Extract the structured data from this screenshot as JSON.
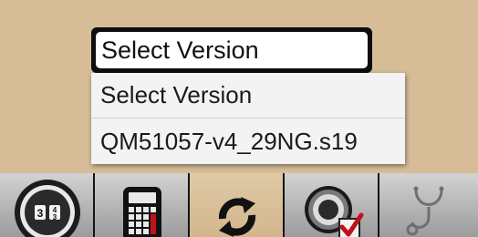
{
  "version_select": {
    "selected": "Select Version"
  },
  "dropdown": {
    "options": [
      "Select Version",
      "QM51057-v4_29NG.s19"
    ]
  },
  "toolbar": {
    "buttons": [
      {
        "icon": "number-dial-icon"
      },
      {
        "icon": "calculator-icon"
      },
      {
        "icon": "refresh-icon"
      },
      {
        "icon": "gauge-check-icon"
      },
      {
        "icon": "stethoscope-icon"
      }
    ],
    "active_index": 2
  },
  "colors": {
    "background": "#d6bd98",
    "toolbar": "#141414",
    "active_button": "#d2b68d",
    "check_mark": "#c0121c"
  }
}
